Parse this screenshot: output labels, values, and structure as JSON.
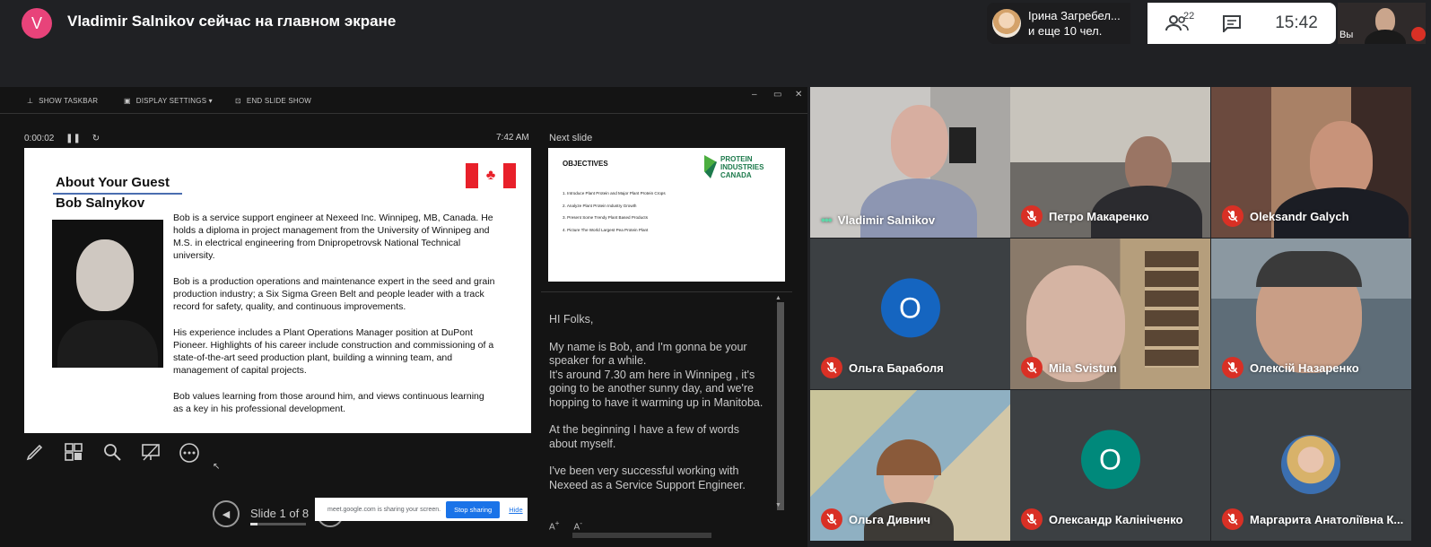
{
  "top_bar": {
    "presenter_initial": "V",
    "presenting_text": "Vladimir Salnikov сейчас на главном экране",
    "participants_chip": {
      "line1": "Ірина Загребел...",
      "line2": "и еще 10 чел."
    },
    "people_count": "22",
    "clock": "15:42",
    "self_label": "Вы"
  },
  "presenter_view": {
    "toolbar": {
      "show_taskbar": "SHOW TASKBAR",
      "display_settings": "DISPLAY SETTINGS ▾",
      "end_slide_show": "END SLIDE SHOW"
    },
    "timer": "0:00:02",
    "clock": "7:42 AM",
    "next_slide_label": "Next slide",
    "slide": {
      "title": "About Your Guest",
      "name": "Bob Salnykov",
      "paragraphs": [
        "Bob is a service support engineer at Nexeed Inc. Winnipeg, MB, Canada. He holds a diploma in project management from the University of Winnipeg and M.S. in electrical engineering from Dnipropetrovsk National Technical university.",
        "Bob is a production operations and maintenance expert in the seed and grain production industry; a Six Sigma Green Belt and people leader with a track record for safety, quality, and continuous improvements.",
        "His experience includes a Plant Operations Manager position at DuPont Pioneer. Highlights of his career include construction and commissioning of a state-of-the-art seed production plant, building a winning team, and management of capital projects.",
        "Bob values learning from those around him, and views continuous learning as a key in his professional development."
      ]
    },
    "next_slide": {
      "title": "OBJECTIVES",
      "logo_text": "PROTEIN INDUSTRIES CANADA",
      "items": [
        "1.   Introduce Plant Protein and Major Plant Protein Crops",
        "2.   Analyze Plant Protein Industry Growth",
        "3.   Present Some Trendy Plant Based Products",
        "4.   Picture The World Largest Pea Protein Plant"
      ]
    },
    "notes": [
      "HI Folks,",
      "My name is Bob, and I'm gonna be your speaker for a while.\nIt's around 7.30 am here in Winnipeg , it's going to be another sunny day, and we're hopping to have it warming up in Manitoba.",
      "At the beginning I have a few of words about myself.",
      "I've been very successful working with Nexeed as a Service Support Engineer."
    ],
    "slide_counter": "Slide 1 of 8",
    "slide_progress": 0.125,
    "share_bar": {
      "message": "meet.google.com is sharing your screen.",
      "stop": "Stop sharing",
      "hide": "Hide"
    }
  },
  "participants": [
    {
      "name": "Vladimir Salnikov",
      "muted": false,
      "speaking": true
    },
    {
      "name": "Петро Макаренко",
      "muted": true
    },
    {
      "name": "Oleksandr Galych",
      "muted": true
    },
    {
      "name": "Ольга Бараболя",
      "muted": true,
      "initial": "O",
      "avatar_color": "#1565c0"
    },
    {
      "name": "Mila Svistun",
      "muted": true
    },
    {
      "name": "Олексій Назаренко",
      "muted": true
    },
    {
      "name": "Ольга Дивнич",
      "muted": true
    },
    {
      "name": "Олександр Калініченко",
      "muted": true,
      "initial": "O",
      "avatar_color": "#00897b"
    },
    {
      "name": "Маргарита Анатоліївна К...",
      "muted": true
    }
  ]
}
